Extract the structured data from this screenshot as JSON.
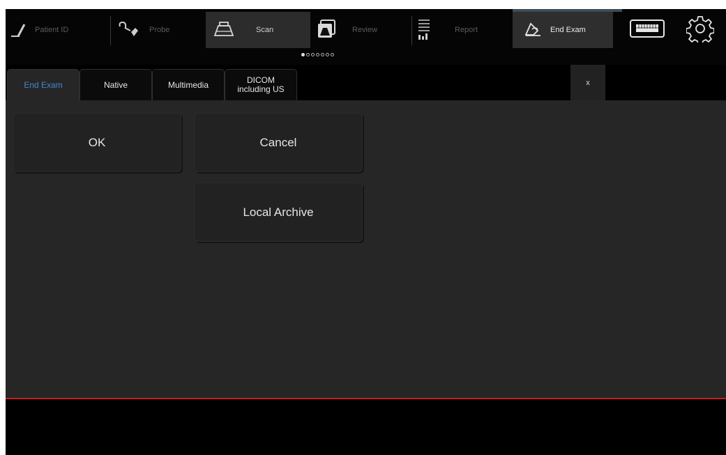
{
  "toolbar": {
    "patient_id": {
      "label": "Patient ID",
      "icon": "pen-icon"
    },
    "probe": {
      "label": "Probe",
      "icon": "probe-icon"
    },
    "scan": {
      "label": "Scan",
      "icon": "scan-icon"
    },
    "review": {
      "label": "Review",
      "icon": "review-icon"
    },
    "report": {
      "label": "Report",
      "icon": "report-icon"
    },
    "end_exam": {
      "label": "End Exam",
      "icon": "end-exam-icon"
    },
    "keyboard": {
      "icon": "keyboard-icon"
    },
    "settings": {
      "icon": "gear-icon"
    },
    "pager_dots": {
      "total": 7,
      "active": 1
    }
  },
  "tabs": [
    {
      "label": "End Exam",
      "active": true
    },
    {
      "label": "Native",
      "active": false
    },
    {
      "label": "Multimedia",
      "active": false
    },
    {
      "label_line1": "DICOM",
      "label_line2": "including US",
      "active": false
    }
  ],
  "close_tab": {
    "label": "x"
  },
  "actions": {
    "ok": "OK",
    "cancel": "Cancel",
    "local_archive": "Local Archive"
  },
  "colors": {
    "active_tab_text": "#3f88cc",
    "separator_line": "#c51e1e",
    "panel_bg": "#262626"
  }
}
